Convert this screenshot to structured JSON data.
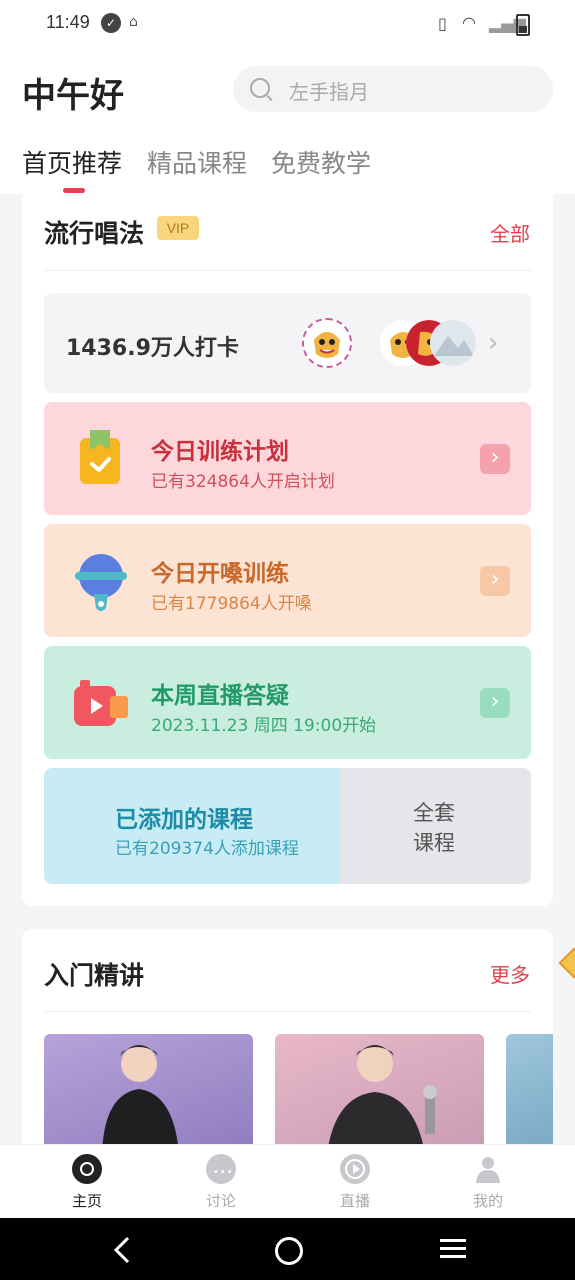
{
  "status_bar": {
    "time": "11:49"
  },
  "header": {
    "greeting": "中午好",
    "search_placeholder": "左手指月",
    "tabs": [
      "首页推荐",
      "精品课程",
      "免费教学"
    ],
    "active_tab": 0
  },
  "popular": {
    "title": "流行唱法",
    "badge": "VIP",
    "more": "全部",
    "checkin": {
      "text": "1436.9万人打卡"
    },
    "plans": [
      {
        "title": "今日训练计划",
        "sub": "已有324864人开启计划",
        "icon": "clipboard-check-icon",
        "bg": "#fdd7dc",
        "title_color": "#c8303c",
        "sub_color": "#d2505c",
        "arrow_bg": "#f4a3ad"
      },
      {
        "title": "今日开嗓训练",
        "sub": "已有1779864人开嗓",
        "icon": "microphone-icon",
        "bg": "#fde3d4",
        "title_color": "#c8682a",
        "sub_color": "#d98647",
        "arrow_bg": "#f8c7a6"
      },
      {
        "title": "本周直播答疑",
        "sub": "2023.11.23 周四 19:00开始",
        "icon": "video-camera-icon",
        "bg": "#c9eedf",
        "title_color": "#229a6a",
        "sub_color": "#35a97b",
        "arrow_bg": "#99dcc0"
      }
    ],
    "added": {
      "title": "已添加的课程",
      "sub": "已有209374人添加课程",
      "right": "全套课程"
    }
  },
  "intro": {
    "title": "入门精讲",
    "more": "更多"
  },
  "bottom_nav": [
    {
      "label": "主页",
      "icon": "home-record-icon",
      "active": true
    },
    {
      "label": "讨论",
      "icon": "chat-bubble-icon",
      "active": false
    },
    {
      "label": "直播",
      "icon": "play-circle-icon",
      "active": false
    },
    {
      "label": "我的",
      "icon": "person-icon",
      "active": false
    }
  ]
}
